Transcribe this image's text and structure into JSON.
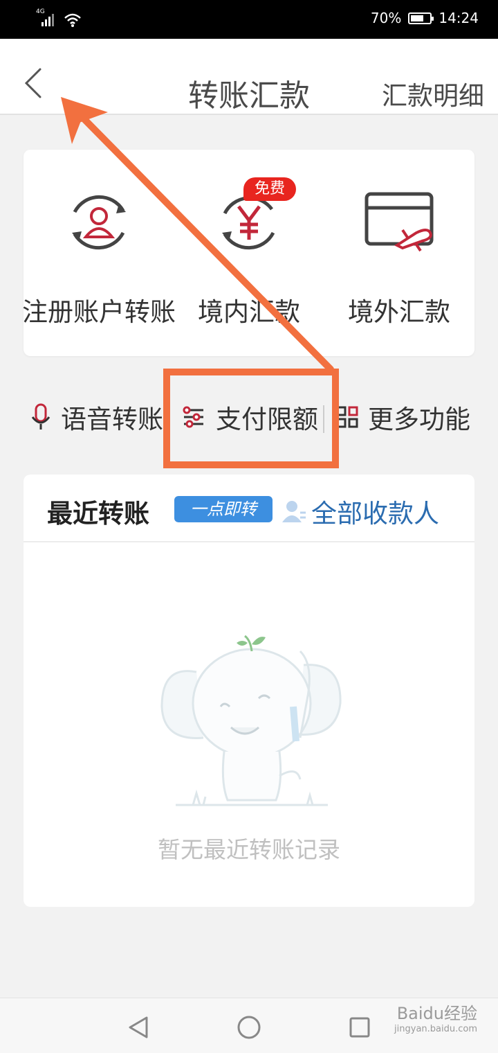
{
  "status_bar": {
    "network": "4G",
    "battery": "70%",
    "battery_level": 0.7,
    "time": "14:24"
  },
  "header": {
    "title": "转账汇款",
    "right_link": "汇款明细"
  },
  "services": [
    {
      "label": "注册账户转账",
      "icon": "user-transfer-icon"
    },
    {
      "label": "境内汇款",
      "icon": "yuan-transfer-icon",
      "badge": "免费"
    },
    {
      "label": "境外汇款",
      "icon": "card-plane-icon"
    }
  ],
  "quick_actions": [
    {
      "label": "语音转账",
      "icon": "microphone-icon"
    },
    {
      "label": "支付限额",
      "icon": "sliders-icon"
    },
    {
      "label": "更多功能",
      "icon": "grid-icon"
    }
  ],
  "recent": {
    "title": "最近转账",
    "badge": "一点即转",
    "link": "全部收款人",
    "empty_text": "暂无最近转账记录"
  },
  "watermark": {
    "brand": "Baidu经验",
    "url": "jingyan.baidu.com"
  },
  "colors": {
    "accent_red": "#e8251f",
    "link_blue": "#2b6cb0",
    "annotation_orange": "#f2703f"
  }
}
